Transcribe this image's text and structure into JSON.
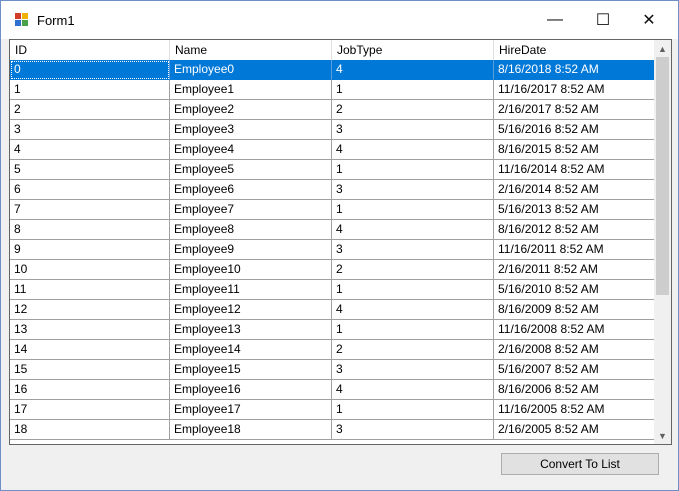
{
  "window": {
    "title": "Form1",
    "minimize_glyph": "—",
    "maximize_glyph": "☐",
    "close_glyph": "✕",
    "icon": "winforms-app-icon"
  },
  "grid": {
    "columns": [
      "ID",
      "Name",
      "JobType",
      "HireDate"
    ],
    "selected_row": 0,
    "rows": [
      [
        "0",
        "Employee0",
        "4",
        "8/16/2018 8:52 AM"
      ],
      [
        "1",
        "Employee1",
        "1",
        "11/16/2017 8:52 AM"
      ],
      [
        "2",
        "Employee2",
        "2",
        "2/16/2017 8:52 AM"
      ],
      [
        "3",
        "Employee3",
        "3",
        "5/16/2016 8:52 AM"
      ],
      [
        "4",
        "Employee4",
        "4",
        "8/16/2015 8:52 AM"
      ],
      [
        "5",
        "Employee5",
        "1",
        "11/16/2014 8:52 AM"
      ],
      [
        "6",
        "Employee6",
        "3",
        "2/16/2014 8:52 AM"
      ],
      [
        "7",
        "Employee7",
        "1",
        "5/16/2013 8:52 AM"
      ],
      [
        "8",
        "Employee8",
        "4",
        "8/16/2012 8:52 AM"
      ],
      [
        "9",
        "Employee9",
        "3",
        "11/16/2011 8:52 AM"
      ],
      [
        "10",
        "Employee10",
        "2",
        "2/16/2011 8:52 AM"
      ],
      [
        "11",
        "Employee11",
        "1",
        "5/16/2010 8:52 AM"
      ],
      [
        "12",
        "Employee12",
        "4",
        "8/16/2009 8:52 AM"
      ],
      [
        "13",
        "Employee13",
        "1",
        "11/16/2008 8:52 AM"
      ],
      [
        "14",
        "Employee14",
        "2",
        "2/16/2008 8:52 AM"
      ],
      [
        "15",
        "Employee15",
        "3",
        "5/16/2007 8:52 AM"
      ],
      [
        "16",
        "Employee16",
        "4",
        "8/16/2006 8:52 AM"
      ],
      [
        "17",
        "Employee17",
        "1",
        "11/16/2005 8:52 AM"
      ],
      [
        "18",
        "Employee18",
        "3",
        "2/16/2005 8:52 AM"
      ]
    ],
    "scroll_up_icon": "chevron-up-icon",
    "scroll_down_icon": "chevron-down-icon"
  },
  "actions": {
    "convert_label": "Convert To List"
  },
  "colors": {
    "selection": "#0078d7",
    "window_border": "#6c8fc7",
    "button_bg": "#e1e1e1"
  }
}
